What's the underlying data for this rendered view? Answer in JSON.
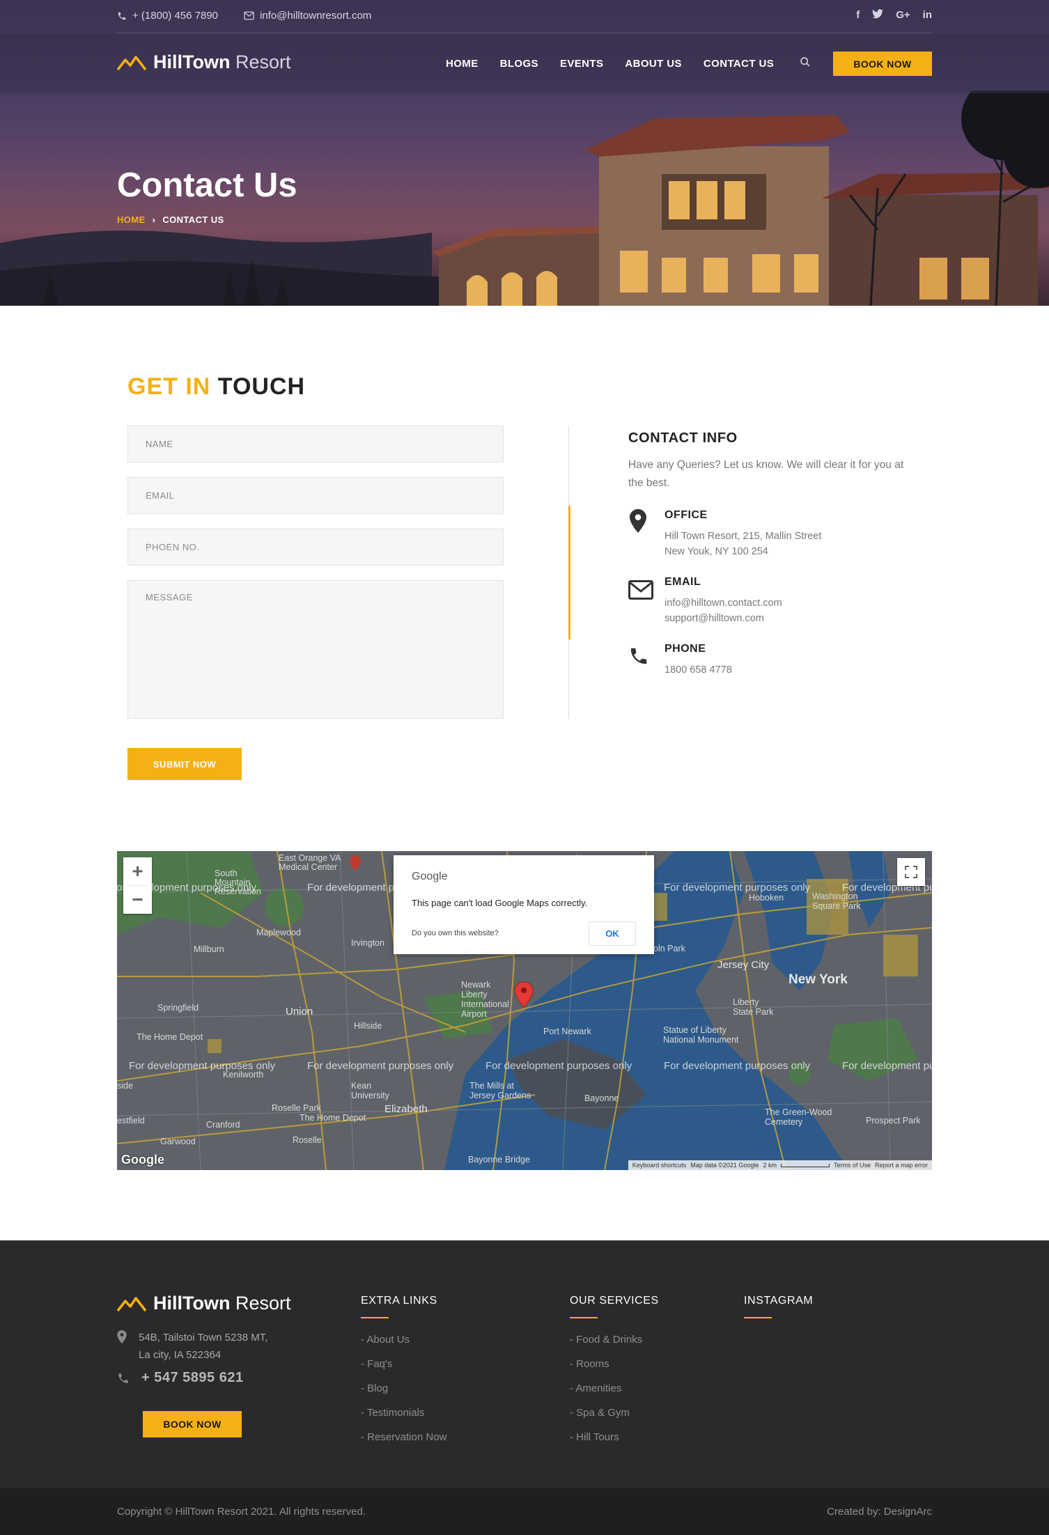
{
  "topbar": {
    "phone": "+ (1800) 456 7890",
    "email": "info@hilltownresort.com",
    "social": [
      "f",
      "t",
      "G+",
      "in"
    ]
  },
  "brand": {
    "bold": "HillTown",
    "light": "Resort"
  },
  "nav": {
    "items": [
      "HOME",
      "BLOGS",
      "EVENTS",
      "ABOUT US",
      "CONTACT US"
    ],
    "book_label": "BOOK NOW"
  },
  "hero": {
    "title": "Contact Us",
    "breadcrumb_home": "HOME",
    "breadcrumb_sep": "›",
    "breadcrumb_current": "CONTACT US"
  },
  "contact_form": {
    "heading_accent": "GET IN",
    "heading_rest": "TOUCH",
    "name_placeholder": "NAME",
    "email_placeholder": "EMAIL",
    "phone_placeholder": "PHOEN NO.",
    "message_placeholder": "MESSAGE",
    "submit_label": "SUBMIT NOW"
  },
  "contact_info": {
    "title": "CONTACT INFO",
    "subtitle": "Have any Queries? Let us know. We will clear it for you at the best.",
    "office": {
      "label": "OFFICE",
      "line1": "Hill Town Resort, 215, Mallin Street",
      "line2": "New Youk, NY 100 254"
    },
    "email": {
      "label": "EMAIL",
      "line1": "info@hilltown.contact.com",
      "line2": "support@hilltown.com"
    },
    "phone": {
      "label": "PHONE",
      "line1": "1800 658 4778"
    }
  },
  "map": {
    "dialog_brand": "Google",
    "dialog_message": "This page can't load Google Maps correctly.",
    "dialog_question": "Do you own this website?",
    "dialog_ok": "OK",
    "watermark": "For development purposes only",
    "logo": "Google",
    "bar": [
      "Keyboard shortcuts",
      "Map data ©2021 Google",
      "2 km",
      "Terms of Use",
      "Report a map error"
    ],
    "labels": {
      "new_york": "New York",
      "jersey_city": "Jersey City",
      "newark_airport": "Newark Liberty International Airport",
      "union": "Union",
      "elizabeth": "Elizabeth",
      "hoboken": "Hoboken",
      "washington_sq": "Washington Square Park",
      "maplewood": "Maplewood",
      "irvington": "Irvington",
      "millburn": "Millburn",
      "springfield": "Springfield",
      "hillside": "Hillside",
      "kenilworth": "Kenilworth",
      "cranford": "Cranford",
      "garwood": "Garwood",
      "roselle": "Roselle",
      "roselle_park": "Roselle Park",
      "bayonne": "Bayonne",
      "port_newark": "Port Newark",
      "liberty_sp": "Liberty State Park",
      "statue": "Statue of Liberty National Monument",
      "prospect_park": "Prospect Park",
      "green_wood": "The Green-Wood Cemetery",
      "kean": "Kean University",
      "home_depot": "The Home Depot",
      "home_depot2": "The Home Depot",
      "mills": "The Mills at Jersey Gardens",
      "east_orange": "East Orange VA Medical Center",
      "south_mountain": "South Mountain Reservation",
      "bayonne_bridge": "Bayonne Bridge",
      "westfield": "estfield",
      "side": "side",
      "ln_park": "oln Park"
    }
  },
  "footer": {
    "address_line1": "54B, Tailstoi Town 5238 MT,",
    "address_line2": "La city, IA 522364",
    "phone": "+ 547 5895 621",
    "book_label": "BOOK NOW",
    "extra_links": {
      "title": "EXTRA LINKS",
      "items": [
        "- About Us",
        "- Faq's",
        "- Blog",
        "- Testimonials",
        "- Reservation Now"
      ]
    },
    "services": {
      "title": "OUR SERVICES",
      "items": [
        "- Food & Drinks",
        "- Rooms",
        "- Amenities",
        "- Spa & Gym",
        "- Hill Tours"
      ]
    },
    "instagram": {
      "title": "INSTAGRAM"
    }
  },
  "bottom": {
    "copyright": "Copyright © HillTown Resort 2021. All rights reserved.",
    "credit": "Created by: DesignArc"
  },
  "colors": {
    "accent": "#f5b113",
    "footer_bg": "#2a2a2c",
    "bottom_bg": "#1f1f21"
  }
}
